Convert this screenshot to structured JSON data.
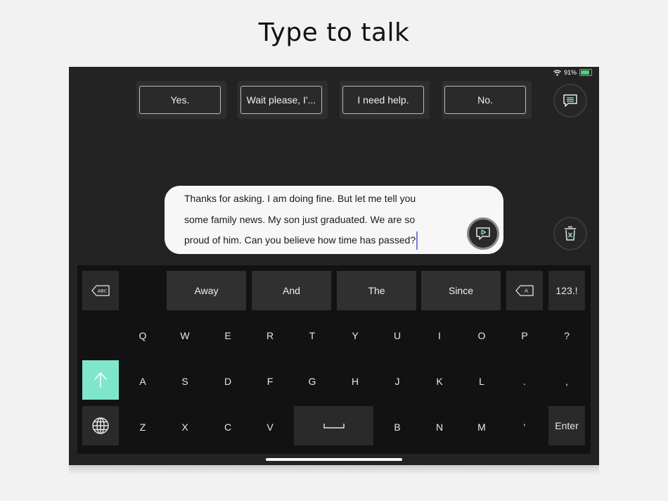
{
  "page": {
    "headline": "Type to talk"
  },
  "status_bar": {
    "battery": "91%",
    "wifi_icon": "wifi-icon",
    "battery_icon": "battery-charging-icon"
  },
  "quick_phrases": [
    "Yes.",
    "Wait please, I'...",
    "I need help.",
    "No."
  ],
  "side_buttons": {
    "phrases_icon": "message-list-icon",
    "clear_icon": "trash-clear-icon"
  },
  "message": {
    "text": "Thanks for asking.  I am doing fine.  But let me tell you some family news.  My son just graduated. We are so proud of him.  Can you believe how time has passed?",
    "speak_icon": "speak-play-icon"
  },
  "keyboard": {
    "predictions": [
      "Away",
      "And",
      "The",
      "Since"
    ],
    "delete_word_icon": "delete-word-abc-icon",
    "delete_char_icon": "delete-char-a-icon",
    "numbers_label": "123.!",
    "row1": [
      "Q",
      "W",
      "E",
      "R",
      "T",
      "Y",
      "U",
      "I",
      "O",
      "P",
      "?"
    ],
    "row2": [
      "A",
      "S",
      "D",
      "F",
      "G",
      "H",
      "J",
      "K",
      "L",
      ".",
      ","
    ],
    "row3_left": [
      "Z",
      "X",
      "C",
      "V"
    ],
    "row3_right": [
      "B",
      "N",
      "M",
      "'"
    ],
    "enter_label": "Enter",
    "shift_icon": "shift-arrow-icon",
    "globe_icon": "globe-icon",
    "space_icon": "space-bar-icon",
    "accent_color": "#7fe6cc"
  }
}
